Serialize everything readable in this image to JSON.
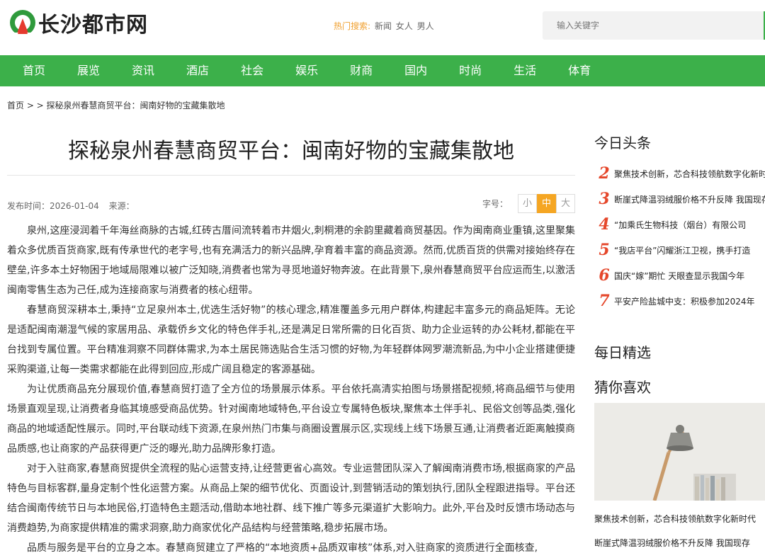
{
  "site": {
    "name": "长沙都市网"
  },
  "hot_search": {
    "label": "热门搜索:",
    "links": [
      "新闻",
      "女人",
      "男人"
    ]
  },
  "search": {
    "placeholder": "输入关键字"
  },
  "nav": [
    "首页",
    "展览",
    "资讯",
    "酒店",
    "社会",
    "娱乐",
    "财商",
    "国内",
    "时尚",
    "生活",
    "体育"
  ],
  "breadcrumb": "首页 > > 探秘泉州春慧商贸平台：闽南好物的宝藏集散地",
  "article": {
    "title": "探秘泉州春慧商贸平台：闽南好物的宝藏集散地",
    "publish_label": "发布时间：",
    "publish_date": "2026-01-04",
    "source_label": "来源：",
    "font_size_label": "字号：",
    "font_sizes": [
      "小",
      "中",
      "大"
    ],
    "font_size_selected": "中",
    "paragraphs": [
      "泉州,这座浸润着千年海丝商脉的古城,红砖古厝间流转着市井烟火,刺桐港的余韵里藏着商贸基因。作为闽南商业重镇,这里聚集着众多优质百货商家,既有传承世代的老字号,也有充满活力的新兴品牌,孕育着丰富的商品资源。然而,优质百货的供需对接始终存在壁垒,许多本土好物困于地域局限难以被广泛知晓,消费者也常为寻觅地道好物奔波。在此背景下,泉州春慧商贸平台应运而生,以激活闽南零售生态为己任,成为连接商家与消费者的核心纽带。",
      "春慧商贸深耕本土,秉持“立足泉州本土,优选生活好物”的核心理念,精准覆盖多元用户群体,构建起丰富多元的商品矩阵。无论是适配闽南潮湿气候的家居用品、承载侨乡文化的特色伴手礼,还是满足日常所需的日化百货、助力企业运转的办公耗材,都能在平台找到专属位置。平台精准洞察不同群体需求,为本土居民筛选贴合生活习惯的好物,为年轻群体网罗潮流新品,为中小企业搭建便捷采购渠道,让每一类需求都能在此得到回应,形成广阔且稳定的客源基础。",
      "为让优质商品充分展现价值,春慧商贸打造了全方位的场景展示体系。平台依托高清实拍图与场景搭配视频,将商品细节与使用场景直观呈现,让消费者身临其境感受商品优势。针对闽南地域特色,平台设立专属特色板块,聚焦本土伴手礼、民俗文创等品类,强化商品的地域适配性展示。同时,平台联动线下资源,在泉州热门市集与商圈设置展示区,实现线上线下场景互通,让消费者近距离触摸商品质感,也让商家的产品获得更广泛的曝光,助力品牌形象打造。",
      "对于入驻商家,春慧商贸提供全流程的贴心运营支持,让经营更省心高效。专业运营团队深入了解闽南消费市场,根据商家的产品特色与目标客群,量身定制个性化运营方案。从商品上架的细节优化、页面设计,到营销活动的策划执行,团队全程跟进指导。平台还结合闽南传统节日与本地民俗,打造特色主题活动,借助本地社群、线下推广等多元渠道扩大影响力。此外,平台及时反馈市场动态与消费趋势,为商家提供精准的需求洞察,助力商家优化产品结构与经营策略,稳步拓展市场。",
      "品质与服务是平台的立身之本。春慧商贸建立了严格的“本地资质+品质双审核”体系,对入驻商家的资质进行全面核查,"
    ]
  },
  "sidebar": {
    "headlines_title": "今日头条",
    "headlines": [
      {
        "num": "2",
        "text": "聚焦技术创新，芯合科技领航数字化新时代"
      },
      {
        "num": "3",
        "text": "断崖式降温羽绒服价格不升反降 我国现存"
      },
      {
        "num": "4",
        "text": "“加乘氏生物科技（烟台）有限公司"
      },
      {
        "num": "5",
        "text": "“我店平台”闪耀浙江卫视，携手打造"
      },
      {
        "num": "6",
        "text": "国庆“嫁”期忙 天眼查显示我国今年"
      },
      {
        "num": "7",
        "text": "平安产险盐城中支：积极参加2024年"
      }
    ],
    "daily_title": "每日精选",
    "guess_title": "猜你喜欢",
    "captions": [
      "聚焦技术创新，芯合科技领航数字化新时代",
      "断崖式降温羽绒服价格不升反降 我国现存"
    ]
  },
  "colors": {
    "brand_green": "#3cb04a",
    "accent_orange": "#f5a623",
    "rank_red": "#e5472b"
  }
}
